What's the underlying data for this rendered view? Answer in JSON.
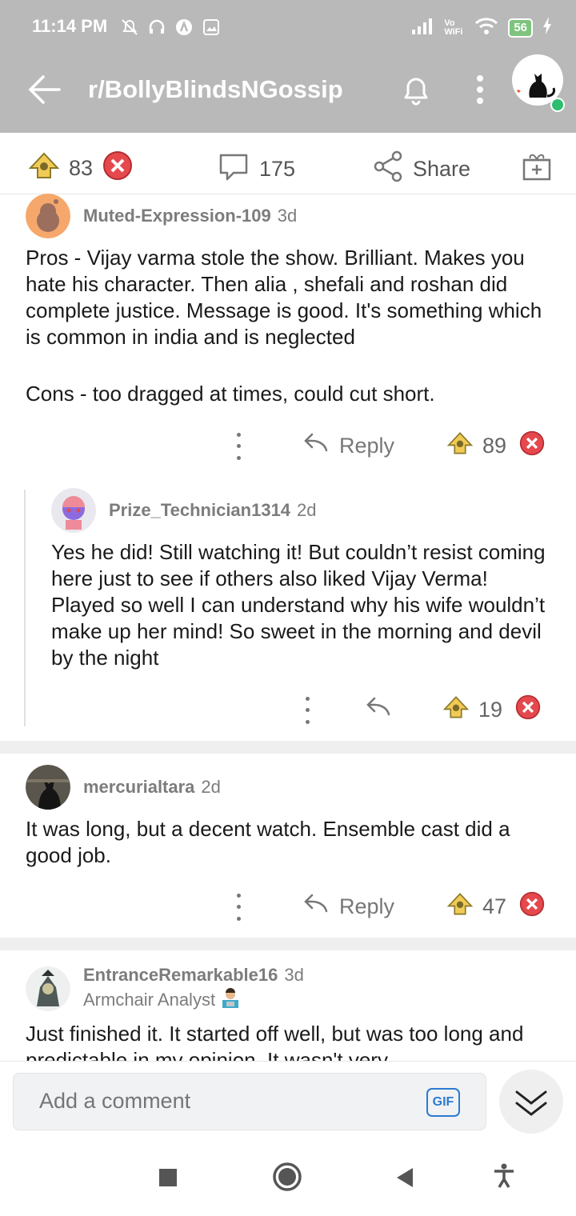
{
  "status_bar": {
    "time": "11:14 PM",
    "network": "Vo WiFi",
    "battery": "56"
  },
  "app_bar": {
    "title": "r/BollyBlindsNGossip"
  },
  "post_actions": {
    "upvotes": "83",
    "comments": "175",
    "share_label": "Share"
  },
  "comments": [
    {
      "username": "Muted-Expression-109",
      "age": "3d",
      "body": [
        "Pros - Vijay varma stole the show. Brilliant.  Makes you hate his character. Then alia , shefali and roshan did complete justice. Message is good. It's something which is common in india and is neglected",
        "Cons - too dragged at times, could cut short."
      ],
      "reply_label": "Reply",
      "score": "89"
    },
    {
      "username": "Prize_Technician1314",
      "age": "2d",
      "body": [
        "Yes he did! Still watching it! But couldn’t resist coming here just to see if others also liked Vijay Verma! Played so well I can understand why his wife wouldn’t make up her mind! So sweet in the morning and devil by the night"
      ],
      "score": "19"
    },
    {
      "username": "mercurialtara",
      "age": "2d",
      "body": [
        "It was long, but a decent watch. Ensemble cast did a good job."
      ],
      "reply_label": "Reply",
      "score": "47"
    },
    {
      "username": "EntranceRemarkable16",
      "age": "3d",
      "flair": "Armchair Analyst",
      "body": [
        "Just finished it. It started off well, but was too long and predictable in my opinion. It wasn't very"
      ]
    }
  ],
  "comment_input": {
    "placeholder": "Add a comment",
    "gif_label": "GIF"
  },
  "colors": {
    "header_bg": "#b9b9b9",
    "online": "#2dbd6e",
    "downvote": "#e5484d",
    "upvote_award": "#e9c04a",
    "gif_blue": "#2a7bd2"
  }
}
